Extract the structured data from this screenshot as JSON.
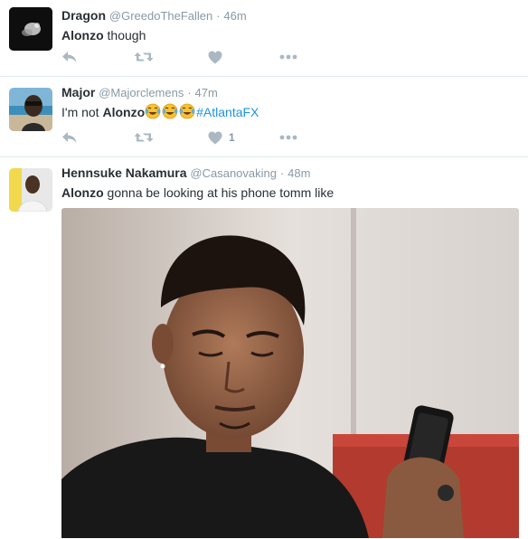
{
  "tweets": [
    {
      "name": "Dragon",
      "handle": "@GreedoTheFallen",
      "separator": "·",
      "time": "46m",
      "text_bold": "Alonzo",
      "text_rest": " though",
      "like_count": ""
    },
    {
      "name": "Major",
      "handle": "@Majorclemens",
      "separator": "·",
      "time": "47m",
      "text_pre": "I'm not ",
      "text_bold": "Alonzo",
      "hashtag": "#AtlantaFX",
      "like_count": "1"
    },
    {
      "name": "Hennsuke Nakamura",
      "handle": "@Casanovaking",
      "separator": "·",
      "time": "48m",
      "text_bold": "Alonzo",
      "text_rest": " gonna be looking at his phone tomm like"
    }
  ],
  "icons": {
    "reply": "reply-icon",
    "retweet": "retweet-icon",
    "like": "heart-icon",
    "more": "more-icon",
    "emoji": "face-with-tears-of-joy"
  },
  "colors": {
    "text": "#292f33",
    "muted": "#8899a6",
    "link": "#1b95e0",
    "icon": "#aab8c2",
    "divider": "#e1e8ed"
  }
}
